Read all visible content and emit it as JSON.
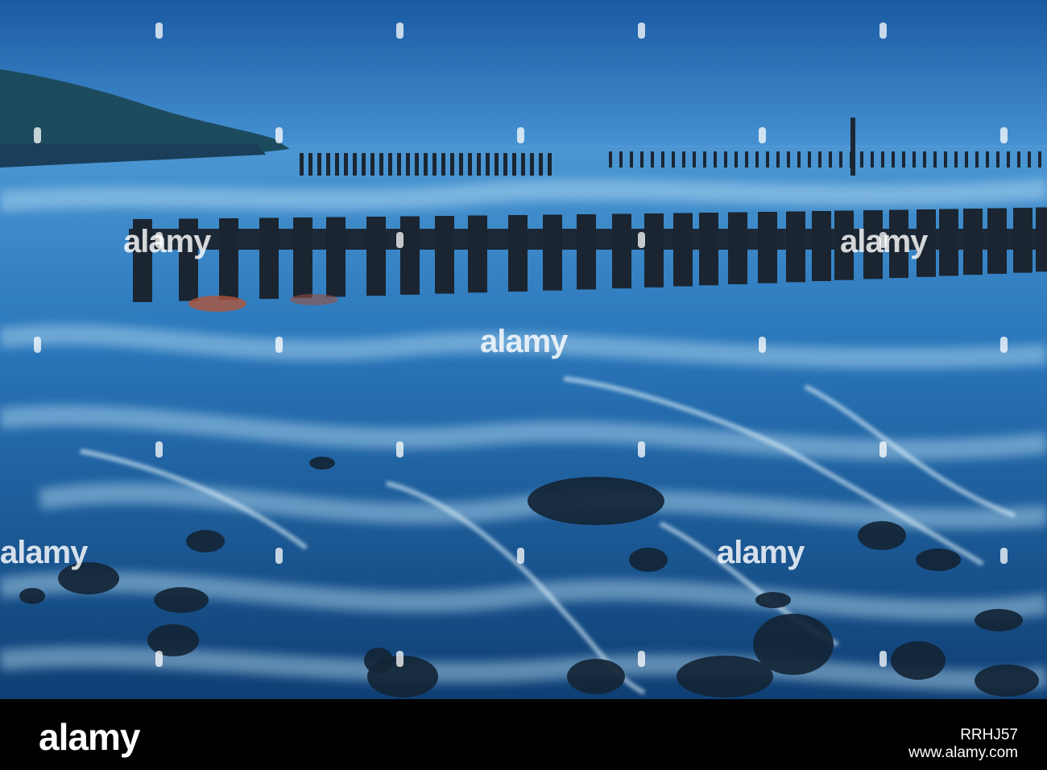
{
  "image": {
    "description_colors": {
      "sky_top": "#1b5fa8",
      "sky_bottom": "#3f8fd0",
      "sea": "#1f6fb0",
      "foam": "#c9e6f7",
      "groyne": "#1b2633",
      "rock": "#12202e",
      "hill": "#1d4e63"
    }
  },
  "watermark": {
    "text": "alamy",
    "dots_symbol": "watermark-dot"
  },
  "footer": {
    "logo": "alamy",
    "image_id": "RRHJ57",
    "url": "www.alamy.com"
  }
}
